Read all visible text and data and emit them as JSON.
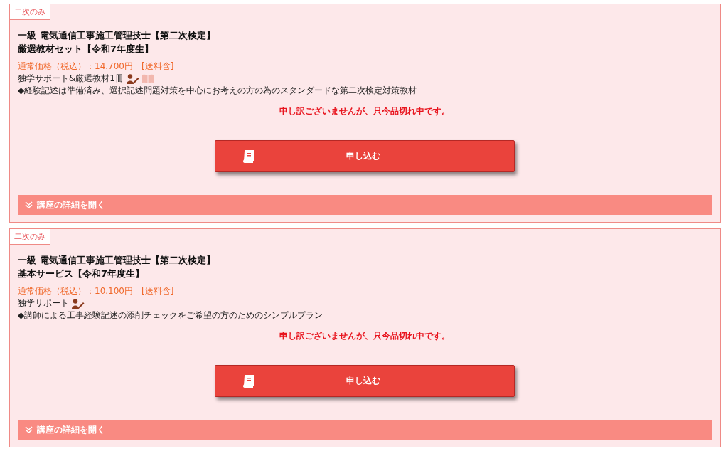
{
  "courses": [
    {
      "tag": "二次のみ",
      "title_lines": [
        "一級 電気通信工事施工管理技士【第二次検定】",
        "厳選教材セット【令和7年度生】"
      ],
      "price": "通常価格（税込）：14.700円　[送料含]",
      "support": "独学サポート&厳選教材1冊",
      "support_icons": [
        {
          "kind": "teacher"
        },
        {
          "kind": "book"
        }
      ],
      "description": "◆経験記述は準備済み、選択記述問題対策を中心にお考えの方の為のスタンダードな第二次検定対策教材",
      "notice": "申し訳ございませんが、只今品切れ中です。",
      "apply_button": "申し込む",
      "details_toggle": {
        "label": "講座の詳細を開く",
        "expanded": false
      }
    },
    {
      "tag": "二次のみ",
      "title_lines": [
        "一級 電気通信工事施工管理技士【第二次検定】",
        "基本サービス【令和7年度生】"
      ],
      "price": "通常価格（税込）：10.100円　[送料含]",
      "support": "独学サポート",
      "support_icons": [
        {
          "kind": "teacher"
        }
      ],
      "description": "◆講師による工事経験記述の添削チェックをご希望の方のためのシンプルプラン",
      "notice": "申し訳ございませんが、只今品切れ中です。",
      "apply_button": "申し込む",
      "details_toggle": {
        "label": "講座の詳細を開く",
        "expanded": false
      }
    }
  ]
}
